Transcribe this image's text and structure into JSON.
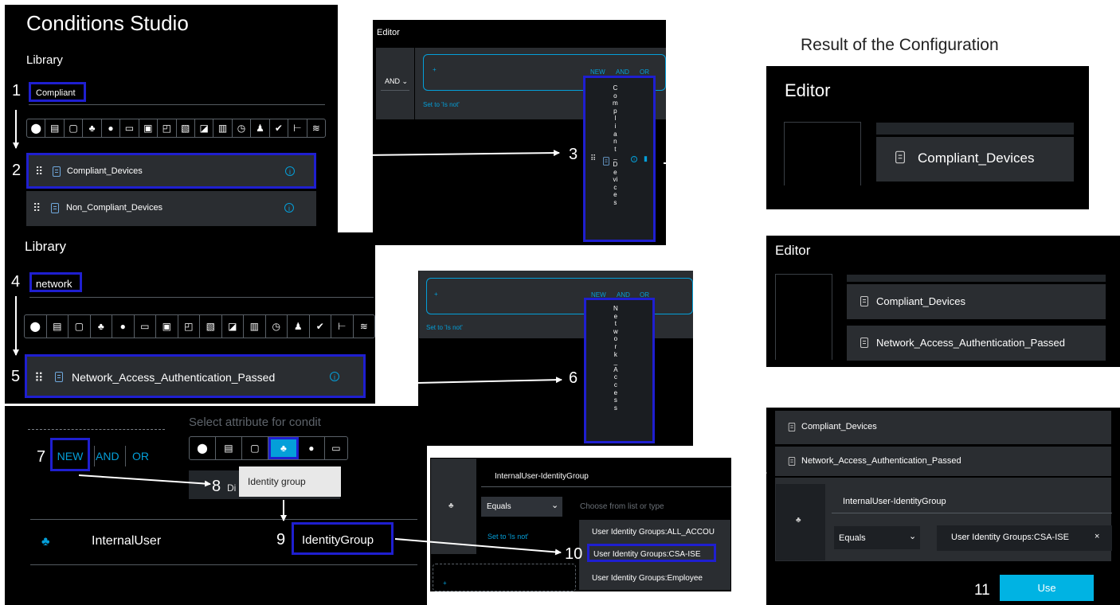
{
  "studio": {
    "title": "Conditions Studio",
    "library_label_1": "Library",
    "library_label_2": "Library"
  },
  "steps": {
    "s1": "1",
    "s2": "2",
    "s3": "3",
    "s4": "4",
    "s5": "5",
    "s6": "6",
    "s7": "7",
    "s8": "8",
    "s9": "9",
    "s10": "10",
    "s11": "11"
  },
  "library1": {
    "search_value": "Compliant",
    "items": [
      {
        "label": "Compliant_Devices"
      },
      {
        "label": "Non_Compliant_Devices"
      }
    ]
  },
  "library2": {
    "search_value": "network",
    "items": [
      {
        "label": "Network_Access_Authentication_Passed"
      }
    ]
  },
  "icon_bar": [
    "location-icon",
    "monitor-icon",
    "square-icon",
    "users-icon",
    "circle-icon",
    "desktop-icon",
    "computer-icon",
    "devices-icon",
    "card-icon",
    "certificate-icon",
    "building-icon",
    "clock-icon",
    "user-icon",
    "check-icon",
    "tree-icon",
    "wifi-icon"
  ],
  "editor1": {
    "label": "Editor",
    "and_select": "AND",
    "new_label": "NEW",
    "and_label": "AND",
    "or_label": "OR",
    "set_to_is_not": "Set to 'Is not'",
    "drag_item_letters": [
      "C",
      "o",
      "m",
      "p",
      "l",
      "i",
      "a",
      "n",
      "t",
      "_",
      "D",
      "e",
      "vi",
      "c",
      "e",
      "s"
    ]
  },
  "editor2": {
    "new_label": "NEW",
    "and_label": "AND",
    "or_label": "OR",
    "set_to_is_not": "Set to 'Is not'",
    "drag_item_letters": [
      "N",
      "e",
      "t",
      "w",
      "o",
      "r",
      "k",
      "_",
      "A",
      "c",
      "c",
      "e",
      "s",
      "s"
    ]
  },
  "result": {
    "heading": "Result of the Configuration",
    "editor_label_1": "Editor",
    "editor_label_2": "Editor",
    "r1_condition": "Compliant_Devices",
    "r2_conditions": [
      "Compliant_Devices",
      "Network_Access_Authentication_Passed"
    ],
    "r3_conditions": [
      "Compliant_Devices",
      "Network_Access_Authentication_Passed"
    ],
    "r3_attribute": "InternalUser-IdentityGroup",
    "r3_operator": "Equals",
    "r3_value": "User Identity Groups:CSA-ISE",
    "r3_value_clear": "×",
    "use_button": "Use"
  },
  "new_bar": {
    "new_label": "NEW",
    "and_label": "AND",
    "or_label": "OR",
    "select_attribute": "Select attribute for condit",
    "tooltip": "Identity group",
    "partial_text": "Di"
  },
  "attribute_row": {
    "dictionary": "InternalUser",
    "attribute": "IdentityGroup"
  },
  "identity_editor": {
    "attribute": "InternalUser-IdentityGroup",
    "operator": "Equals",
    "value_placeholder": "Choose from list or type",
    "set_to_is_not": "Set to 'Is not'",
    "options": [
      "User Identity Groups:ALL_ACCOU",
      "User Identity Groups:CSA-ISE",
      "User Identity Groups:Employee"
    ]
  },
  "colors": {
    "highlight": "#1f1fd0",
    "accent": "#049fd9",
    "use_button": "#00b3e3"
  }
}
